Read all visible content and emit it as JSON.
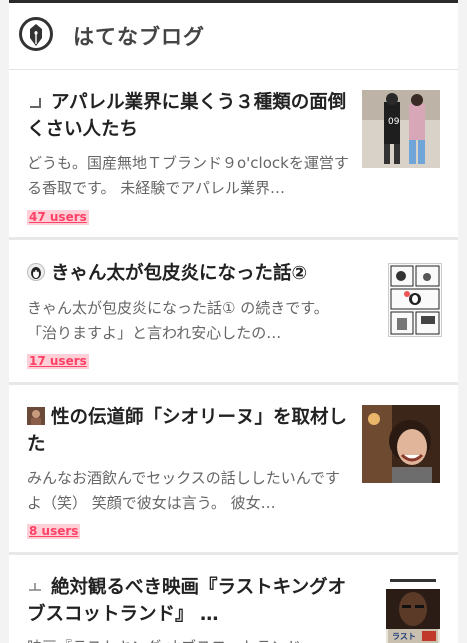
{
  "header": {
    "title": "はてなブログ",
    "logo_icon": "hatena-blog-pen-icon"
  },
  "entries": [
    {
      "title": "アパレル業界に巣くう３種類の面倒くさい人たち",
      "description": "どうも。国産無地Ｔブランド９o'clockを運営する香取です。 未経験でアパレル業界…",
      "users": "47 users",
      "favicon": "blog-favicon-icon",
      "thumbnail": "fashion-street-photo"
    },
    {
      "title": "きゃん太が包皮炎になった話②",
      "description": "きゃん太が包皮炎になった話① の続きです。 「治りますよ」と言われ安心したの…",
      "users": "17 users",
      "favicon": "penguin-avatar-icon",
      "thumbnail": "manga-comic-page"
    },
    {
      "title": "性の伝道師「シオリーヌ」を取材した",
      "description": "みんなお酒飲んでセックスの話ししたいんですよ（笑） 笑顔で彼女は言う。 彼女…",
      "users": "8 users",
      "favicon": "blog-avatar-icon",
      "thumbnail": "laughing-woman-photo"
    },
    {
      "title": "絶対観るべき映画『ラストキングオブスコットランド』 …",
      "description": "映画『ラストキング オブスコットランド』",
      "users": "",
      "favicon": "blog-favicon-icon",
      "thumbnail": "movie-poster"
    }
  ]
}
